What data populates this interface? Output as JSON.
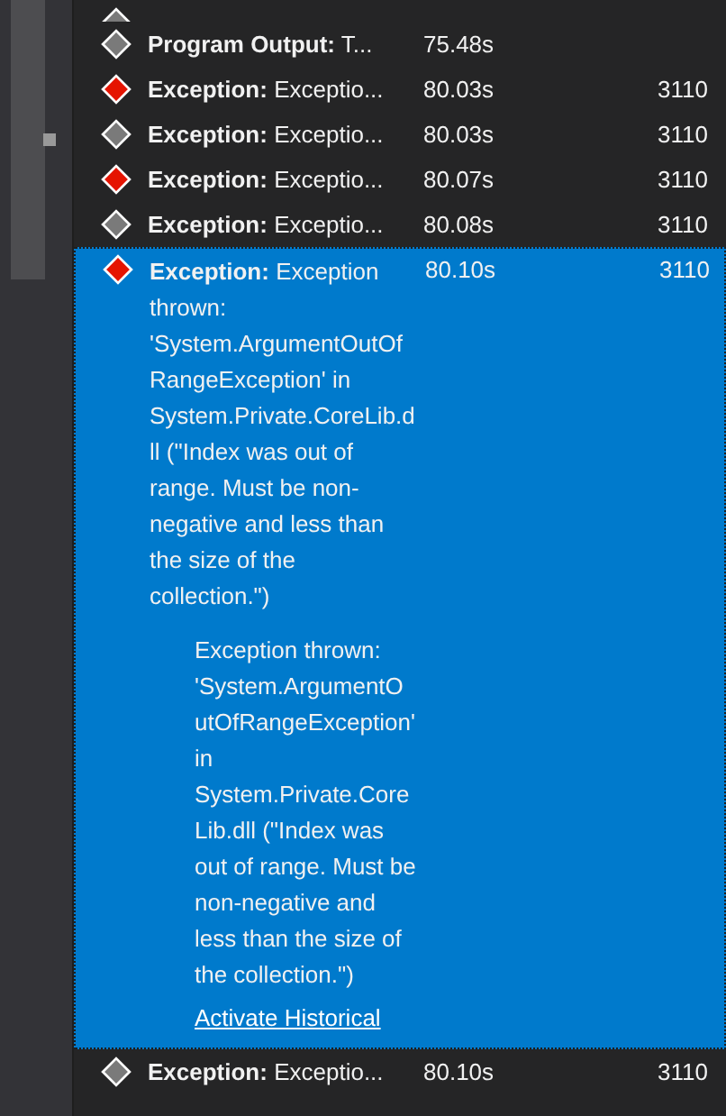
{
  "events": [
    {
      "category": "Program Output:",
      "summary": "T...",
      "time": "75.48s",
      "selected": false,
      "color": "#7a7a7a"
    },
    {
      "category": "Exception:",
      "summary": "Exceptio...",
      "time": "80.03s",
      "thread": "3110",
      "selected": false,
      "color": "#e51400"
    },
    {
      "category": "Exception:",
      "summary": "Exceptio...",
      "time": "80.03s",
      "thread": "3110",
      "selected": false,
      "color": "#7a7a7a"
    },
    {
      "category": "Exception:",
      "summary": "Exceptio...",
      "time": "80.07s",
      "thread": "3110",
      "selected": false,
      "color": "#e51400"
    },
    {
      "category": "Exception:",
      "summary": "Exceptio...",
      "time": "80.08s",
      "thread": "3110",
      "selected": false,
      "color": "#7a7a7a"
    },
    {
      "category": "Exception:",
      "summary": "Exception thrown: 'System.ArgumentOutOfRangeException' in System.Private.CoreLib.dll (\"Index was out of range. Must be non-negative and less than the size of the collection.\")",
      "time": "80.10s",
      "thread": "3110",
      "selected": true,
      "color": "#e51400",
      "detail": "Exception thrown: 'System.ArgumentOutOfRangeException' in System.Private.CoreLib.dll (\"Index was out of range. Must be non-negative and less than the size of the collection.\")",
      "link": "Activate Historical"
    },
    {
      "category": "Exception:",
      "summary": "Exceptio...",
      "time": "80.10s",
      "thread": "3110",
      "selected": false,
      "color": "#7a7a7a"
    }
  ]
}
